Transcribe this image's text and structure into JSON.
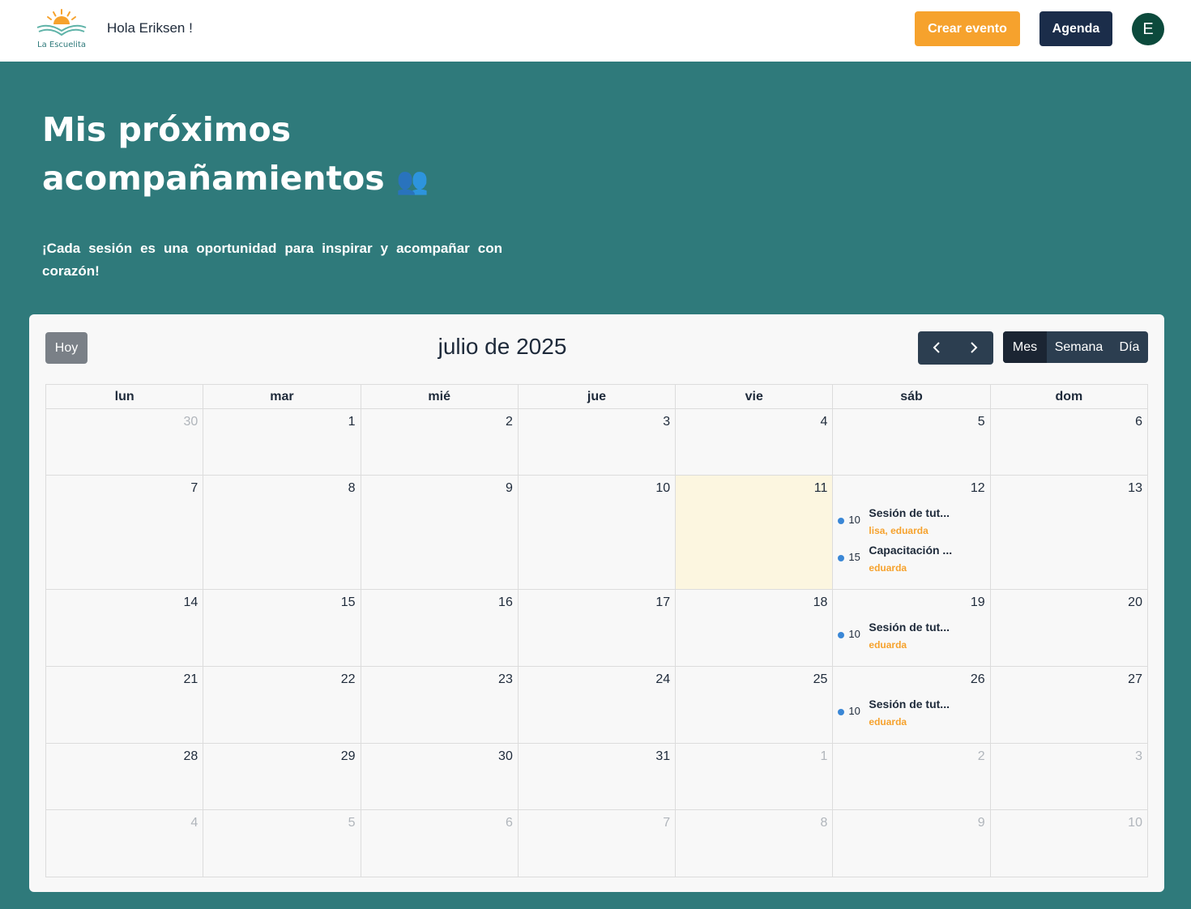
{
  "header": {
    "logo_text": "La Escuelita",
    "greeting": "Hola Eriksen !",
    "create_label": "Crear evento",
    "agenda_label": "Agenda",
    "avatar_initial": "E"
  },
  "hero": {
    "title_line1": "Mis próximos",
    "title_line2": "acompañamientos",
    "title_emoji": "👥",
    "subtitle": "¡Cada sesión es una oportunidad para inspirar y acompañar con corazón!"
  },
  "calendar": {
    "today_label": "Hoy",
    "title": "julio de 2025",
    "prev_icon": "‹",
    "next_icon": "›",
    "views": [
      "Mes",
      "Semana",
      "Día"
    ],
    "active_view": "Mes",
    "weekdays": [
      "lun",
      "mar",
      "mié",
      "jue",
      "vie",
      "sáb",
      "dom"
    ],
    "weeks": [
      [
        {
          "day": "30",
          "other": true
        },
        {
          "day": "1"
        },
        {
          "day": "2"
        },
        {
          "day": "3"
        },
        {
          "day": "4"
        },
        {
          "day": "5"
        },
        {
          "day": "6"
        }
      ],
      [
        {
          "day": "7"
        },
        {
          "day": "8"
        },
        {
          "day": "9"
        },
        {
          "day": "10"
        },
        {
          "day": "11",
          "today": true
        },
        {
          "day": "12",
          "events": [
            {
              "time": "10",
              "title": "Sesión de tut...",
              "people": "lisa, eduarda"
            },
            {
              "time": "15",
              "title": "Capacitación ...",
              "people": "eduarda"
            }
          ]
        },
        {
          "day": "13"
        }
      ],
      [
        {
          "day": "14"
        },
        {
          "day": "15"
        },
        {
          "day": "16"
        },
        {
          "day": "17"
        },
        {
          "day": "18"
        },
        {
          "day": "19",
          "events": [
            {
              "time": "10",
              "title": "Sesión de tut...",
              "people": "eduarda"
            }
          ]
        },
        {
          "day": "20"
        }
      ],
      [
        {
          "day": "21"
        },
        {
          "day": "22"
        },
        {
          "day": "23"
        },
        {
          "day": "24"
        },
        {
          "day": "25"
        },
        {
          "day": "26",
          "events": [
            {
              "time": "10",
              "title": "Sesión de tut...",
              "people": "eduarda"
            }
          ]
        },
        {
          "day": "27"
        }
      ],
      [
        {
          "day": "28"
        },
        {
          "day": "29"
        },
        {
          "day": "30"
        },
        {
          "day": "31"
        },
        {
          "day": "1",
          "other": true
        },
        {
          "day": "2",
          "other": true
        },
        {
          "day": "3",
          "other": true
        }
      ],
      [
        {
          "day": "4",
          "other": true
        },
        {
          "day": "5",
          "other": true
        },
        {
          "day": "6",
          "other": true
        },
        {
          "day": "7",
          "other": true
        },
        {
          "day": "8",
          "other": true
        },
        {
          "day": "9",
          "other": true
        },
        {
          "day": "10",
          "other": true
        }
      ]
    ]
  },
  "colors": {
    "teal": "#2f7a7b",
    "orange": "#f6a22d",
    "navy": "#1b2d4a",
    "today_bg": "#fcf6e0",
    "event_dot": "#3a87d6"
  }
}
